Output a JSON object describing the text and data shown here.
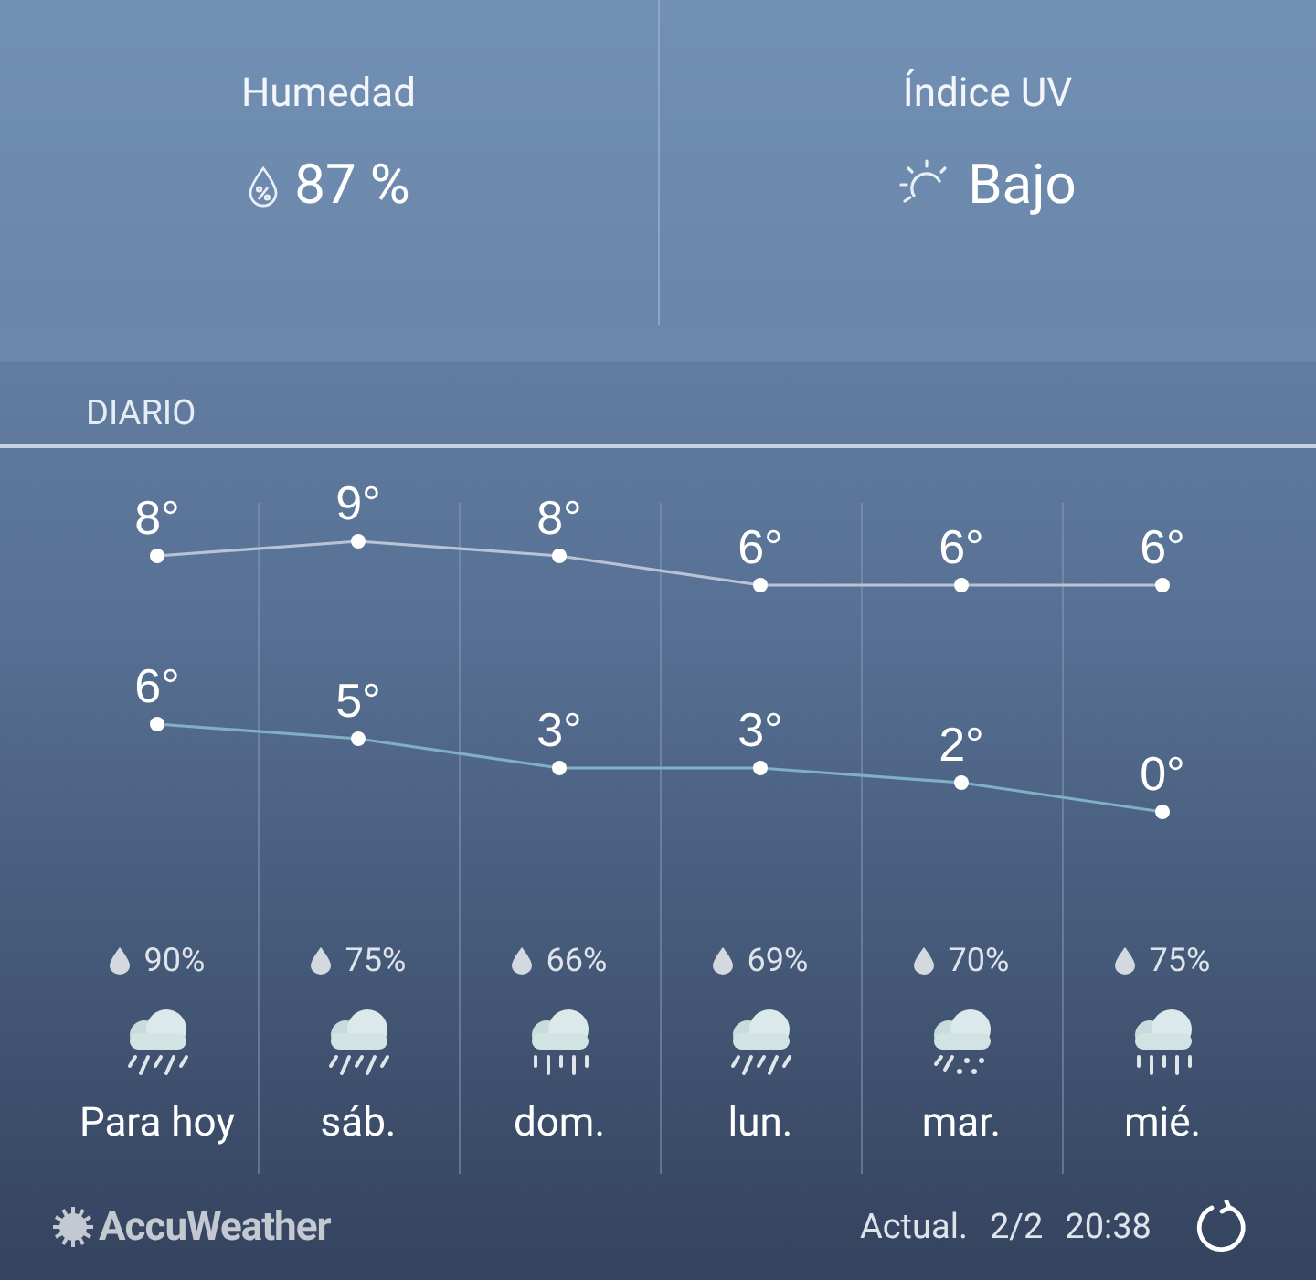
{
  "current": [
    {
      "kind": "humidity",
      "label": "Humedad",
      "value": "87 %"
    },
    {
      "kind": "uv",
      "label": "Índice UV",
      "value": "Bajo"
    }
  ],
  "section_title": "DIARIO",
  "days": [
    {
      "label": "Para hoy",
      "precip": "90%",
      "kind": "rain-slant"
    },
    {
      "label": "sáb.",
      "precip": "75%",
      "kind": "rain-slant"
    },
    {
      "label": "dom.",
      "precip": "66%",
      "kind": "rain"
    },
    {
      "label": "lun.",
      "precip": "69%",
      "kind": "rain-slant"
    },
    {
      "label": "mar.",
      "precip": "70%",
      "kind": "mix"
    },
    {
      "label": "mié.",
      "precip": "75%",
      "kind": "rain"
    }
  ],
  "high_temperatures": {
    "chart_data": {
      "type": "line",
      "data_labels": true,
      "series": [
        {
          "color": "#b8c4d6",
          "marker": "o",
          "values": [
            8,
            9,
            8,
            6,
            6,
            6
          ],
          "value_labels": [
            "8°",
            "9°",
            "8°",
            "6°",
            "6°",
            "6°"
          ]
        }
      ]
    }
  },
  "low_temperatures": {
    "chart_data": {
      "type": "line",
      "data_labels": true,
      "series": [
        {
          "color": "#7fb0c4",
          "marker": "o",
          "values": [
            6,
            5,
            3,
            3,
            2,
            0
          ],
          "value_labels": [
            "6°",
            "5°",
            "3°",
            "3°",
            "2°",
            "0°"
          ]
        }
      ]
    }
  },
  "footer": {
    "brand": "AccuWeather",
    "updated_label": "Actual.",
    "date": "2/2",
    "time": "20:38"
  }
}
